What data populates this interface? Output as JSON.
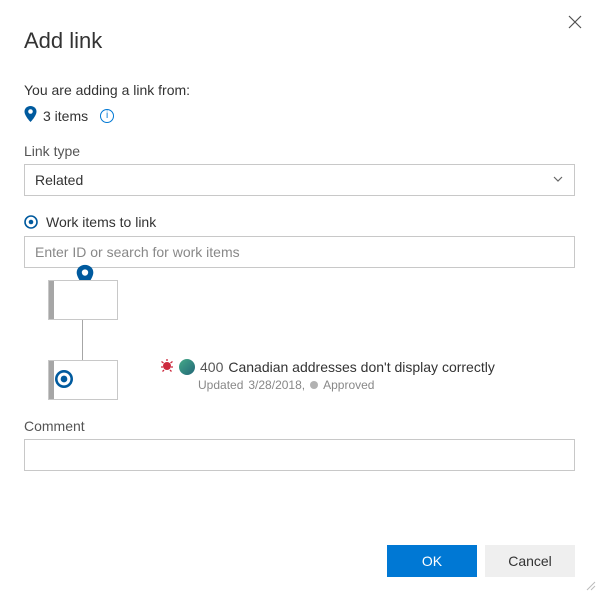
{
  "dialog": {
    "title": "Add link",
    "intro": "You are adding a link from:",
    "items_count": "3 items"
  },
  "link_type": {
    "label": "Link type",
    "selected": "Related"
  },
  "work_items": {
    "label": "Work items to link",
    "placeholder": "Enter ID or search for work items",
    "linked": {
      "id": "400",
      "title": "Canadian addresses don't display correctly",
      "updated_prefix": "Updated",
      "updated_date": "3/28/2018,",
      "state": "Approved"
    }
  },
  "comment": {
    "label": "Comment",
    "value": ""
  },
  "buttons": {
    "ok": "OK",
    "cancel": "Cancel"
  }
}
